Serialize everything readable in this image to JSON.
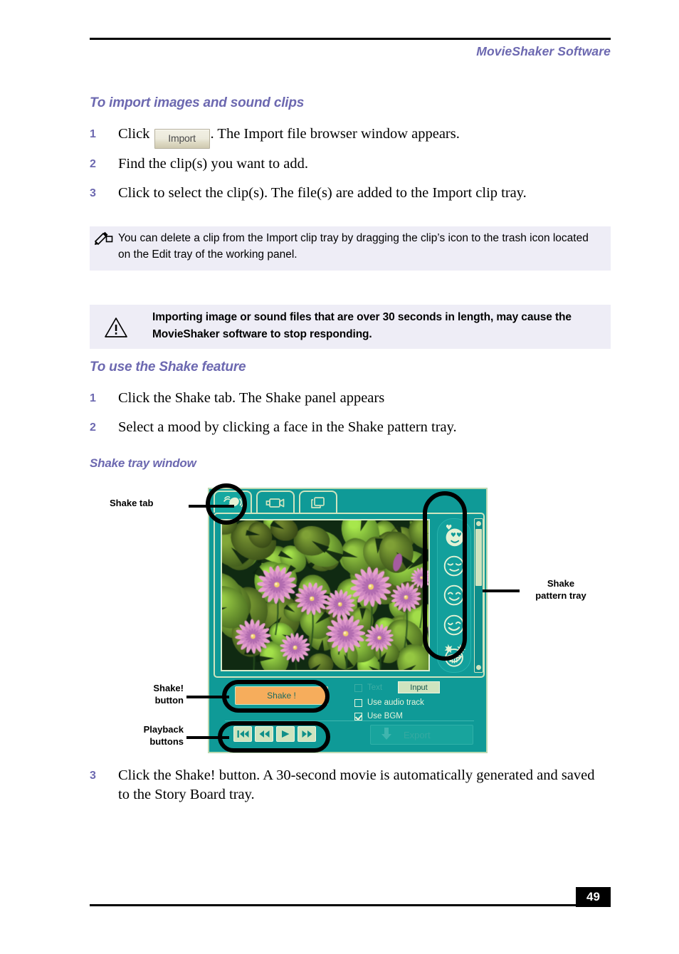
{
  "header": {
    "title": "MovieShaker Software"
  },
  "footer": {
    "page_number": "49"
  },
  "sections": {
    "import_heading": "To import images and sound clips",
    "shake_heading": "To use the Shake feature",
    "tray_heading": "Shake tray window"
  },
  "steps": {
    "import": [
      {
        "num": "1",
        "text_before": "Click",
        "button_label": "Import",
        "text_after": ". The Import file browser window appears."
      },
      {
        "num": "2",
        "text": "Find the clip(s) you want to add."
      },
      {
        "num": "3",
        "text": "Click to select the clip(s). The file(s) are added to the Import clip tray."
      }
    ],
    "shake": [
      {
        "num": "1",
        "text": "Click the Shake tab. The Shake panel appears"
      },
      {
        "num": "2",
        "text": "Select a mood by clicking a face in the Shake pattern tray."
      }
    ],
    "after_figure": {
      "num": "3",
      "text": "Click the Shake! button. A 30-second movie is automatically generated and saved to the Story Board tray."
    }
  },
  "note_box": {
    "icon": "pencil-note-icon",
    "text": "You can delete a clip from the Import clip tray by dragging the clip’s icon to the trash icon located on the Edit tray of the working panel."
  },
  "warning_box": {
    "icon": "warning-triangle-icon",
    "text": "Importing image or sound files that are over 30 seconds in length, may cause the MovieShaker software to stop responding."
  },
  "figure": {
    "callouts": {
      "shake_tab": "Shake tab",
      "pattern_tray": "Shake\npattern tray",
      "shake_button": "Shake!\nbutton",
      "playback_buttons": "Playback\nbuttons"
    },
    "app": {
      "tabs": [
        {
          "name": "shake-tab",
          "icon": "maraca-shaker-icon",
          "active": true
        },
        {
          "name": "capture-tab",
          "icon": "video-camera-icon",
          "active": false
        },
        {
          "name": "storyboard-tab",
          "icon": "stacked-frames-icon",
          "active": false
        }
      ],
      "preview": {
        "image_description": "water lilies"
      },
      "pattern_tray": {
        "moods": [
          {
            "name": "mood-love",
            "icon": "heart-eyes-face-icon",
            "selected": true
          },
          {
            "name": "mood-calm",
            "icon": "calm-face-icon",
            "selected": false
          },
          {
            "name": "mood-happy",
            "icon": "smiling-face-icon",
            "selected": false
          },
          {
            "name": "mood-playful",
            "icon": "winking-face-icon",
            "selected": false
          },
          {
            "name": "mood-wild",
            "icon": "star-eyes-grinning-face-icon",
            "selected": false
          }
        ]
      },
      "controls": {
        "shake_button_label": "Shake !",
        "input_button_label": "Input",
        "export_button_label": "Export",
        "checkboxes": [
          {
            "label": "Text",
            "checked": false,
            "disabled": true
          },
          {
            "label": "Use audio track",
            "checked": false,
            "disabled": false
          },
          {
            "label": "Use BGM",
            "checked": true,
            "disabled": false
          }
        ],
        "playback": [
          {
            "name": "skip-back-button",
            "icon": "skip-backward-icon"
          },
          {
            "name": "rewind-button",
            "icon": "rewind-icon"
          },
          {
            "name": "play-button",
            "icon": "play-icon"
          },
          {
            "name": "fast-forward-button",
            "icon": "fast-forward-icon"
          }
        ]
      }
    }
  },
  "colors": {
    "heading_purple": "#6c68b0",
    "callout_bg": "#eeedf6",
    "app_teal": "#0f9a97",
    "app_border_green": "#cfe4bf",
    "shake_orange": "#f6ad5c"
  }
}
